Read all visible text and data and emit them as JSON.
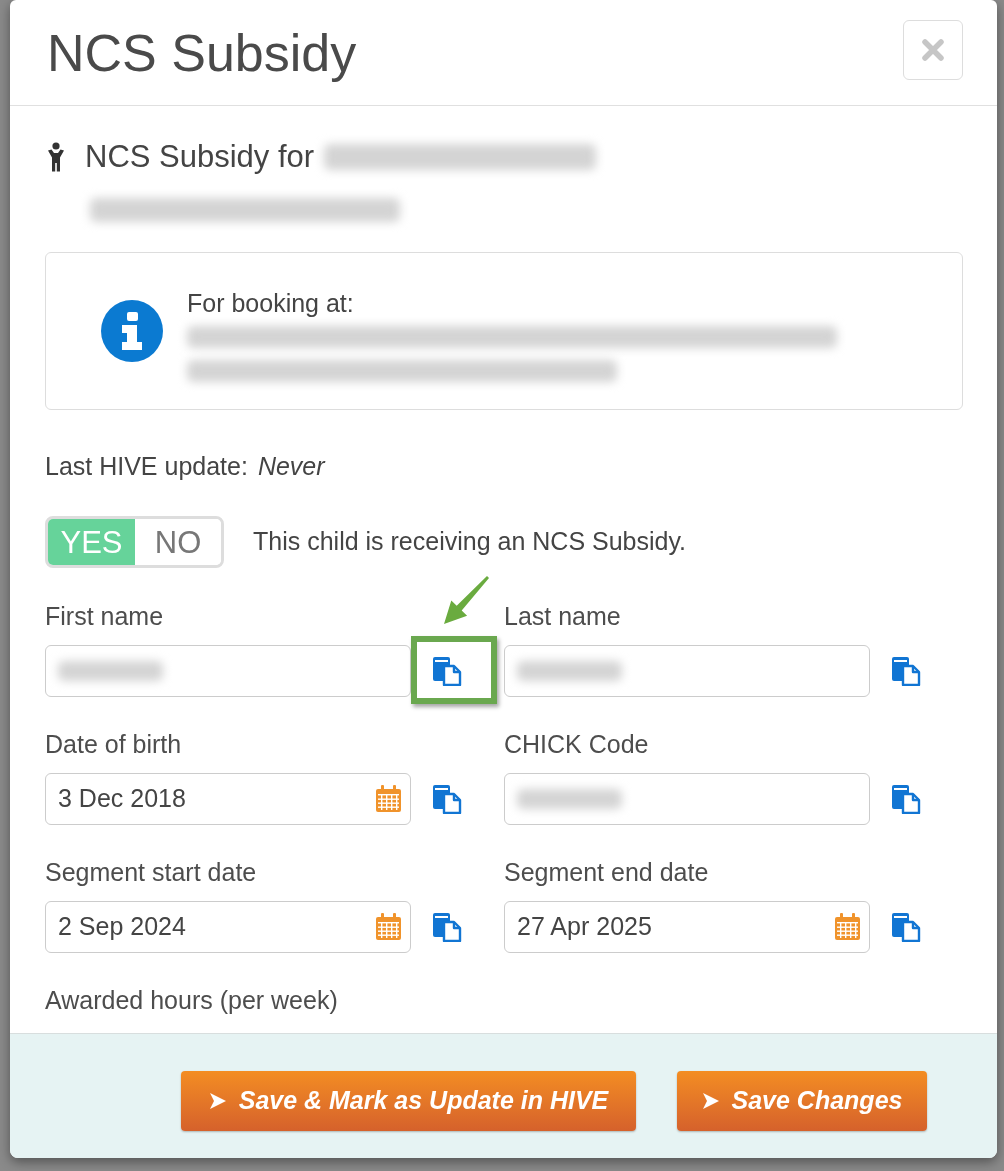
{
  "modal": {
    "title": "NCS Subsidy"
  },
  "subject": {
    "heading": "NCS Subsidy for",
    "name_blurred": true,
    "code_blurred": true
  },
  "booking_info": {
    "title": "For booking at:",
    "details_blurred": true
  },
  "last_update": {
    "label": "Last HIVE update:",
    "value": "Never"
  },
  "subsidy_toggle": {
    "options": [
      {
        "label": "YES",
        "selected": true
      },
      {
        "label": "NO",
        "selected": false
      }
    ],
    "caption": "This child is receiving an NCS Subsidy."
  },
  "fields": [
    {
      "label": "First name",
      "kind": "text",
      "value_blurred": true,
      "copy_highlighted": true
    },
    {
      "label": "Last name",
      "kind": "text",
      "value_blurred": true,
      "copy_highlighted": false
    },
    {
      "label": "Date of birth",
      "kind": "date",
      "value": "3 Dec 2018",
      "value_blurred": false,
      "copy_highlighted": false
    },
    {
      "label": "CHICK Code",
      "kind": "text",
      "value_blurred": true,
      "copy_highlighted": false
    },
    {
      "label": "Segment start date",
      "kind": "date",
      "value": "2 Sep 2024",
      "value_blurred": false,
      "copy_highlighted": false
    },
    {
      "label": "Segment end date",
      "kind": "date",
      "value": "27 Apr 2025",
      "value_blurred": false,
      "copy_highlighted": false
    },
    {
      "label": "Awarded hours (per week)",
      "kind": "label"
    }
  ],
  "footer_buttons": [
    "Save & Mark as Update in HIVE",
    "Save Changes"
  ]
}
